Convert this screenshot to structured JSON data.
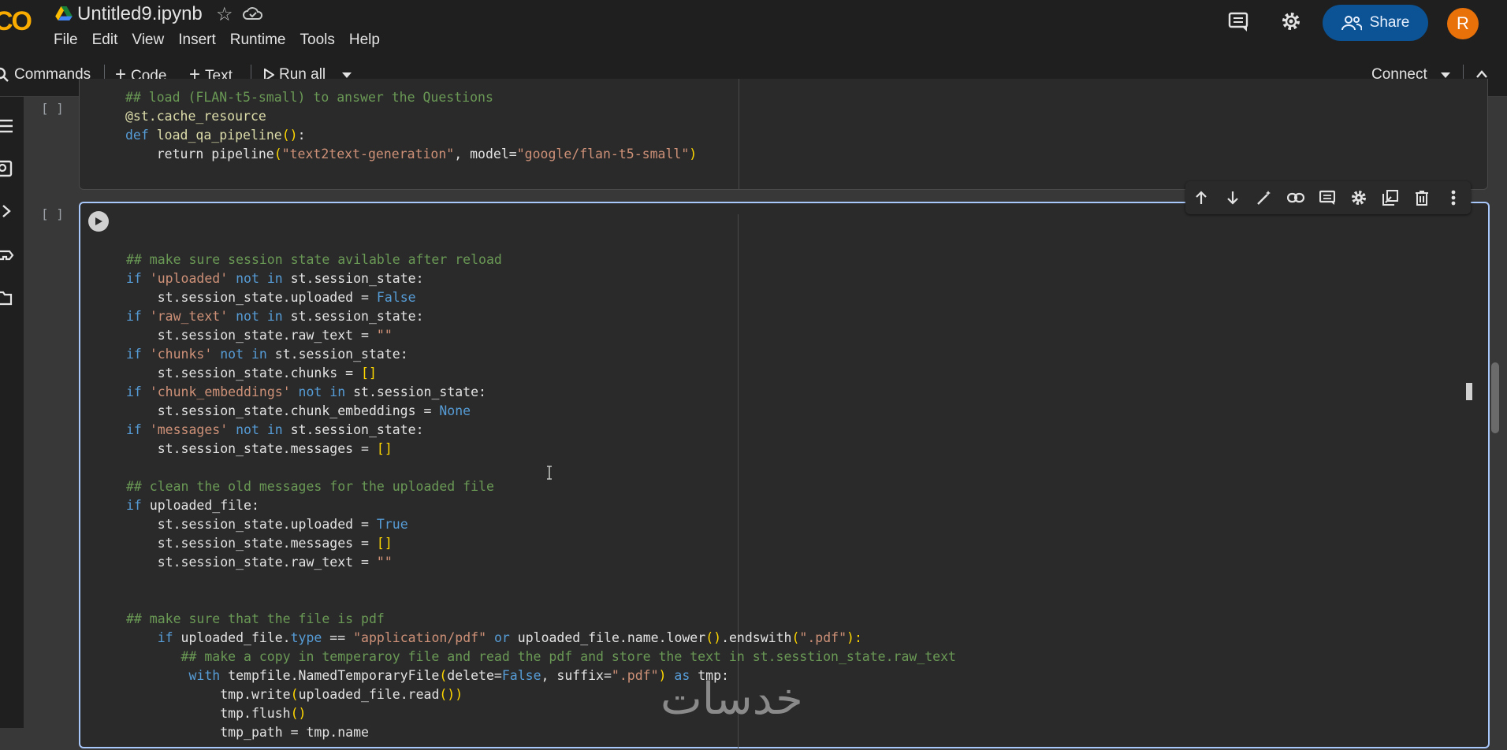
{
  "app": {
    "title": "Untitled9.ipynb",
    "logo": "CO"
  },
  "menu": [
    "File",
    "Edit",
    "View",
    "Insert",
    "Runtime",
    "Tools",
    "Help"
  ],
  "header": {
    "share_label": "Share",
    "avatar_initial": "R"
  },
  "toolbar": {
    "commands_label": "Commands",
    "code_label": "Code",
    "text_label": "Text",
    "run_all_label": "Run all",
    "connect_label": "Connect"
  },
  "cells": [
    {
      "exec": "[ ]",
      "lines": [
        [
          [
            "c",
            "## load (FLAN-t5-small) to answer the Questions"
          ]
        ],
        [
          [
            "d",
            "@st.cache_resource"
          ]
        ],
        [
          [
            "k",
            "def "
          ],
          [
            "d",
            "load_qa_pipeline"
          ],
          [
            "b",
            "()"
          ],
          [
            "p",
            ":"
          ]
        ],
        [
          [
            "p",
            "    return pipeline"
          ],
          [
            "b",
            "("
          ],
          [
            "s",
            "\"text2text-generation\""
          ],
          [
            "p",
            ", model="
          ],
          [
            "s",
            "\"google/flan-t5-small\""
          ],
          [
            "b",
            ")"
          ]
        ]
      ]
    },
    {
      "exec": "[ ]",
      "lines": [
        [
          [
            "p",
            ""
          ]
        ],
        [
          [
            "c",
            "## make sure session state avilable after reload"
          ]
        ],
        [
          [
            "k",
            "if "
          ],
          [
            "s",
            "'uploaded'"
          ],
          [
            "k",
            " not in "
          ],
          [
            "p",
            "st.session_state:"
          ]
        ],
        [
          [
            "p",
            "    st.session_state.uploaded = "
          ],
          [
            "k",
            "False"
          ]
        ],
        [
          [
            "k",
            "if "
          ],
          [
            "s",
            "'raw_text'"
          ],
          [
            "k",
            " not in "
          ],
          [
            "p",
            "st.session_state:"
          ]
        ],
        [
          [
            "p",
            "    st.session_state.raw_text = "
          ],
          [
            "s",
            "\"\""
          ]
        ],
        [
          [
            "k",
            "if "
          ],
          [
            "s",
            "'chunks'"
          ],
          [
            "k",
            " not in "
          ],
          [
            "p",
            "st.session_state:"
          ]
        ],
        [
          [
            "p",
            "    st.session_state.chunks = "
          ],
          [
            "b",
            "[]"
          ]
        ],
        [
          [
            "k",
            "if "
          ],
          [
            "s",
            "'chunk_embeddings'"
          ],
          [
            "k",
            " not in "
          ],
          [
            "p",
            "st.session_state:"
          ]
        ],
        [
          [
            "p",
            "    st.session_state.chunk_embeddings = "
          ],
          [
            "k",
            "None"
          ]
        ],
        [
          [
            "k",
            "if "
          ],
          [
            "s",
            "'messages'"
          ],
          [
            "k",
            " not in "
          ],
          [
            "p",
            "st.session_state:"
          ]
        ],
        [
          [
            "p",
            "    st.session_state.messages = "
          ],
          [
            "b",
            "[]"
          ]
        ],
        [
          [
            "p",
            ""
          ]
        ],
        [
          [
            "c",
            "## clean the old messages for the uploaded file"
          ]
        ],
        [
          [
            "k",
            "if "
          ],
          [
            "p",
            "uploaded_file:"
          ]
        ],
        [
          [
            "p",
            "    st.session_state.uploaded = "
          ],
          [
            "k",
            "True"
          ]
        ],
        [
          [
            "p",
            "    st.session_state.messages = "
          ],
          [
            "b",
            "[]"
          ]
        ],
        [
          [
            "p",
            "    st.session_state.raw_text = "
          ],
          [
            "s",
            "\"\""
          ]
        ],
        [
          [
            "p",
            ""
          ]
        ],
        [
          [
            "p",
            ""
          ]
        ],
        [
          [
            "c",
            "## make sure that the file is pdf"
          ]
        ],
        [
          [
            "k",
            "    if "
          ],
          [
            "p",
            "uploaded_file."
          ],
          [
            "k",
            "type"
          ],
          [
            "p",
            " == "
          ],
          [
            "s",
            "\"application/pdf\""
          ],
          [
            "k",
            " or "
          ],
          [
            "p",
            "uploaded_file.name.lower"
          ],
          [
            "b",
            "()"
          ],
          [
            "p",
            ".endswith"
          ],
          [
            "b",
            "("
          ],
          [
            "s",
            "\".pdf\""
          ],
          [
            "b",
            "):"
          ]
        ],
        [
          [
            "c",
            "       ## make a copy in temperaroy file and read the pdf and store the text in st.sesstion_state.raw_text"
          ]
        ],
        [
          [
            "k",
            "        with "
          ],
          [
            "p",
            "tempfile.NamedTemporaryFile"
          ],
          [
            "b",
            "("
          ],
          [
            "p",
            "delete="
          ],
          [
            "k",
            "False"
          ],
          [
            "p",
            ", suffix="
          ],
          [
            "s",
            "\".pdf\""
          ],
          [
            "b",
            ")"
          ],
          [
            "k",
            " as "
          ],
          [
            "p",
            "tmp:"
          ]
        ],
        [
          [
            "p",
            "            tmp.write"
          ],
          [
            "b",
            "("
          ],
          [
            "p",
            "uploaded_file.read"
          ],
          [
            "b",
            "())"
          ]
        ],
        [
          [
            "p",
            "            tmp.flush"
          ],
          [
            "b",
            "()"
          ]
        ],
        [
          [
            "p",
            "            tmp_path = tmp.name"
          ]
        ]
      ]
    }
  ],
  "watermark": "خدسات",
  "icons": [
    "google-drive-icon",
    "star-icon",
    "cloud-icon",
    "comment-icon",
    "settings-icon",
    "people-icon",
    "search-icon",
    "plus-icon",
    "play-icon",
    "caret-down-icon",
    "chevron-up-icon",
    "arrow-up-icon",
    "arrow-down-icon",
    "magic-edit-icon",
    "link-icon",
    "comment-icon",
    "gear-icon",
    "mirror-cell-icon",
    "delete-icon",
    "more-vert-icon"
  ]
}
